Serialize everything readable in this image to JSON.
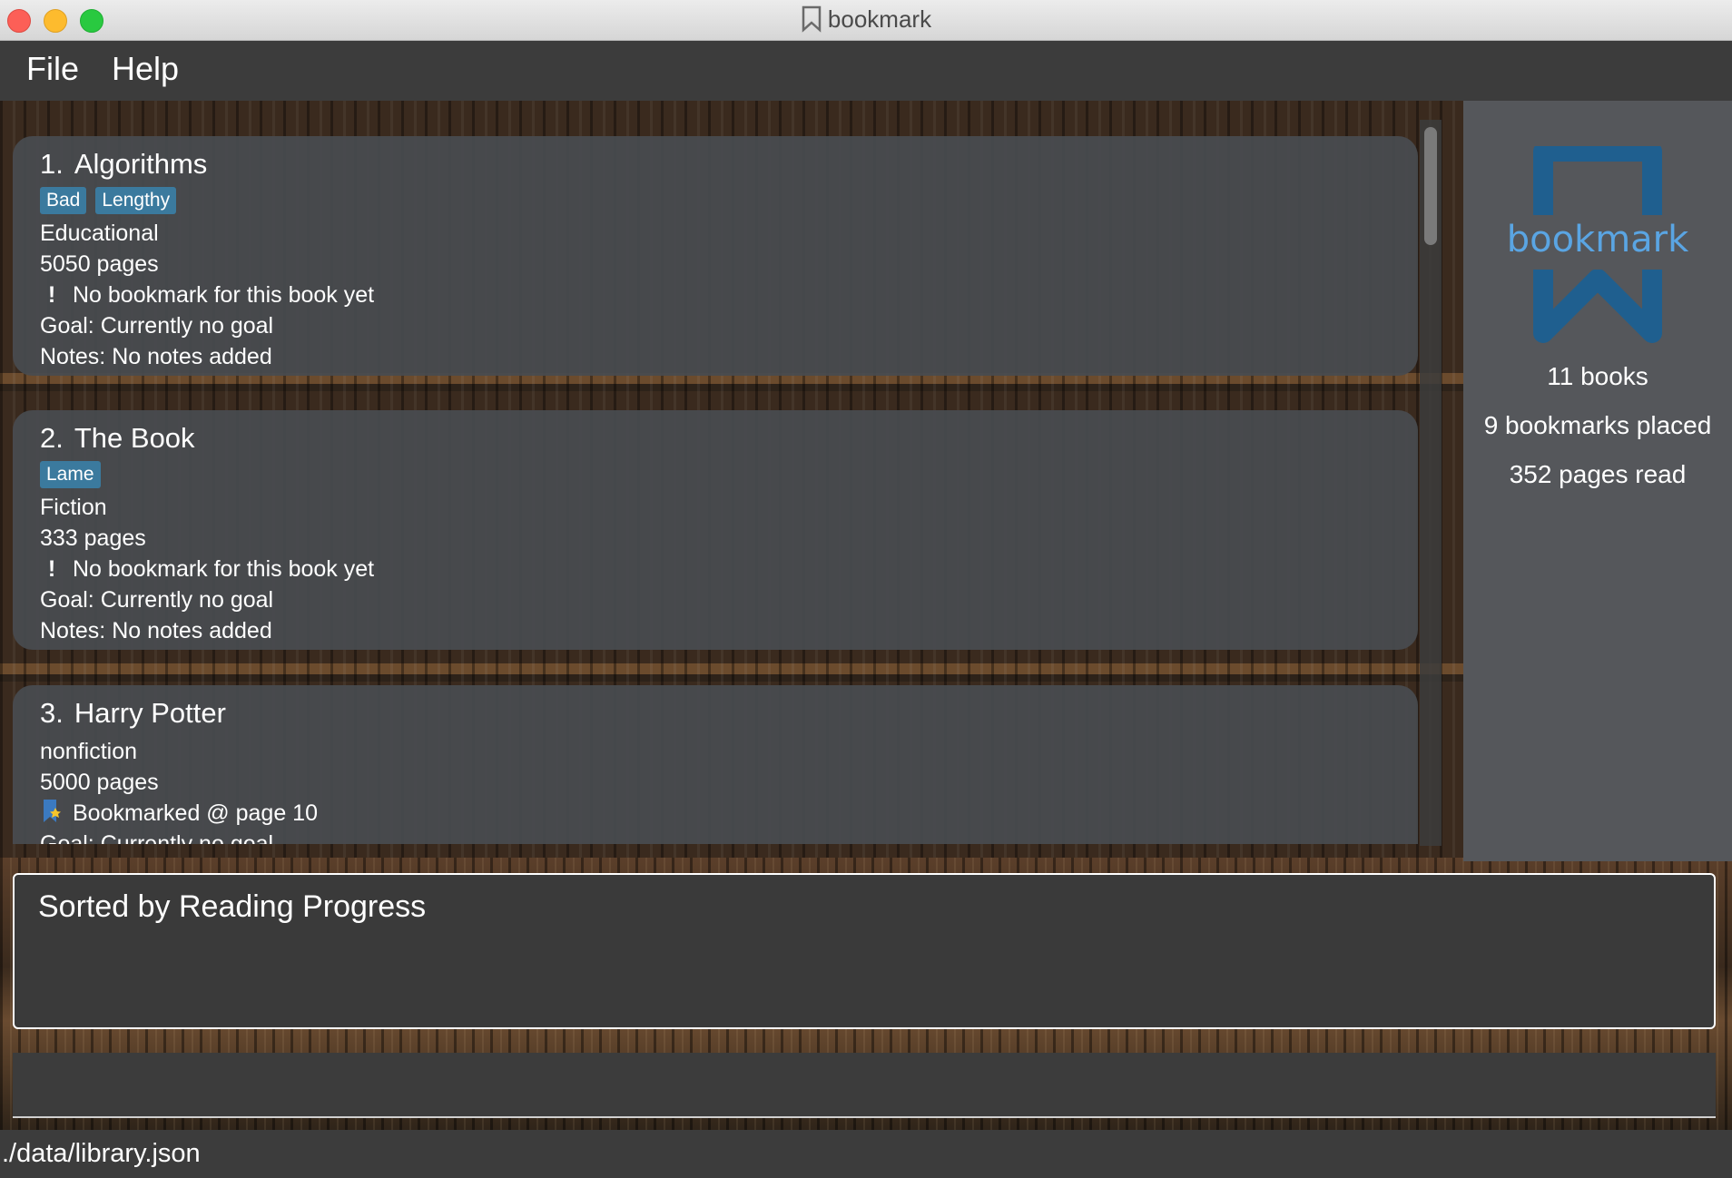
{
  "window": {
    "title": "bookmark"
  },
  "menu": {
    "file": "File",
    "help": "Help"
  },
  "books": [
    {
      "index": "1.",
      "title": "Algorithms",
      "tags": [
        "Bad",
        "Lengthy"
      ],
      "genre": "Educational",
      "pages": "5050 pages",
      "bookmark_icon": "exclamation-icon",
      "bookmark": "No bookmark for this book yet",
      "goal": "Goal: Currently no goal",
      "notes": "Notes: No notes added"
    },
    {
      "index": "2.",
      "title": "The Book",
      "tags": [
        "Lame"
      ],
      "genre": "Fiction",
      "pages": "333 pages",
      "bookmark_icon": "exclamation-icon",
      "bookmark": "No bookmark for this book yet",
      "goal": "Goal: Currently no goal",
      "notes": "Notes: No notes added"
    },
    {
      "index": "3.",
      "title": "Harry Potter",
      "tags": [],
      "genre": "nonfiction",
      "pages": "5000 pages",
      "bookmark_icon": "bookmark-star-icon",
      "bookmark": "Bookmarked @ page 10",
      "goal": "Goal: Currently no goal"
    }
  ],
  "side_panel": {
    "logo_text": "bookmark",
    "books_count": "11 books",
    "bookmarks_placed": "9 bookmarks placed",
    "pages_read": "352 pages read"
  },
  "result_display": {
    "text": "Sorted by Reading Progress"
  },
  "command_box": {
    "value": ""
  },
  "status_bar": {
    "path": "./data/library.json"
  },
  "colors": {
    "tag": "#3b7a9e",
    "logo": "#5aa5e3",
    "logo_frame": "#1f5f8f",
    "card": "#484b50"
  }
}
